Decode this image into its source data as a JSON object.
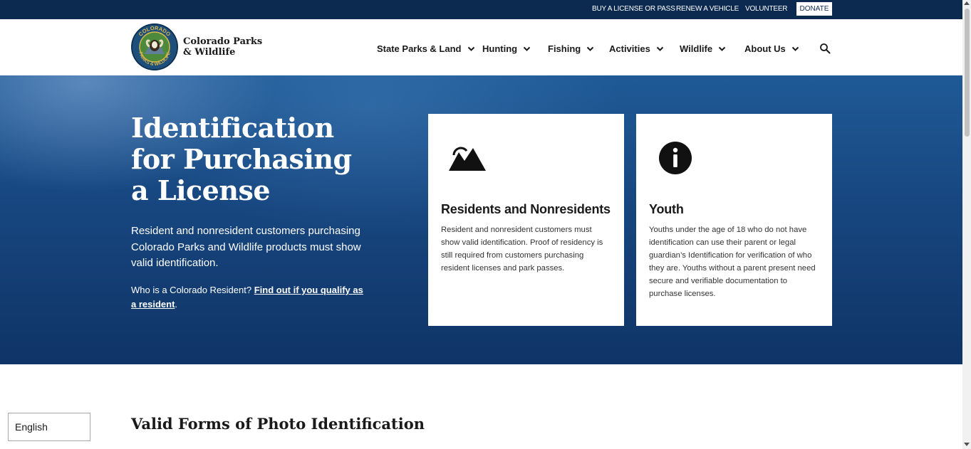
{
  "utility": {
    "buy_license": "BUY A LICENSE OR PASS",
    "renew_vehicle": "RENEW A VEHICLE",
    "volunteer": "VOLUNTEER",
    "donate": "DONATE"
  },
  "header": {
    "logo_text_line1": "Colorado Parks",
    "logo_text_line2": "& Wildlife",
    "logo_ring_text": "COLORADO PARKS & WILDLIFE",
    "nav": [
      {
        "label": "State Parks & Land"
      },
      {
        "label": "Hunting"
      },
      {
        "label": "Fishing"
      },
      {
        "label": "Activities"
      },
      {
        "label": "Wildlife"
      },
      {
        "label": "About Us"
      }
    ],
    "search_icon": "search-icon"
  },
  "hero": {
    "title": "Identification for Purchasing a License",
    "description": "Resident and nonresident customers purchasing Colorado Parks and Wildlife products must show valid identification.",
    "resident_question": "Who is a Colorado Resident?",
    "resident_link": "Find out if you qualify as a resident",
    "resident_suffix": "."
  },
  "cards": [
    {
      "icon": "mountain-icon",
      "title": "Residents and Nonresidents",
      "text": "Resident and nonresident customers must show valid identification. Proof of residency is still required from customers purchasing resident licenses and park passes."
    },
    {
      "icon": "info-icon",
      "title": "Youth",
      "text": "Youths under the age of 18 who do not have identification can use their parent or legal guardian’s Identification for verification of who they are. Youths without a parent present need secure and verifiable documentation to purchase licenses."
    }
  ],
  "main": {
    "section_title": "Valid Forms of Photo Identification"
  },
  "language": {
    "selected": "English"
  },
  "colors": {
    "utility_bar": "#0c2a4f",
    "hero_blue": "#17467f",
    "text_dark": "#1a1a1a"
  }
}
